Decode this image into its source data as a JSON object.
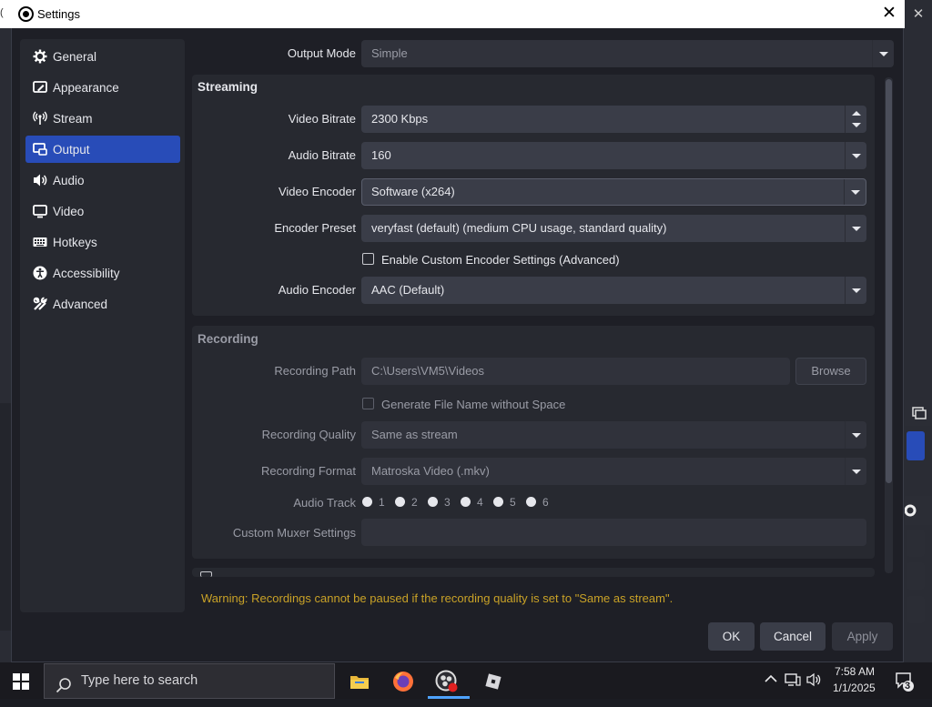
{
  "window": {
    "title": "Settings"
  },
  "sidebar": {
    "items": [
      {
        "label": "General",
        "icon": "gear-icon",
        "active": false
      },
      {
        "label": "Appearance",
        "icon": "paintbrush-icon",
        "active": false
      },
      {
        "label": "Stream",
        "icon": "broadcast-icon",
        "active": false
      },
      {
        "label": "Output",
        "icon": "output-icon",
        "active": true
      },
      {
        "label": "Audio",
        "icon": "speaker-icon",
        "active": false
      },
      {
        "label": "Video",
        "icon": "monitor-icon",
        "active": false
      },
      {
        "label": "Hotkeys",
        "icon": "keyboard-icon",
        "active": false
      },
      {
        "label": "Accessibility",
        "icon": "accessibility-icon",
        "active": false
      },
      {
        "label": "Advanced",
        "icon": "tools-icon",
        "active": false
      }
    ]
  },
  "output": {
    "mode_label": "Output Mode",
    "mode_value": "Simple",
    "streaming": {
      "title": "Streaming",
      "video_bitrate_label": "Video Bitrate",
      "video_bitrate_value": "2300 Kbps",
      "audio_bitrate_label": "Audio Bitrate",
      "audio_bitrate_value": "160",
      "video_encoder_label": "Video Encoder",
      "video_encoder_value": "Software (x264)",
      "encoder_preset_label": "Encoder Preset",
      "encoder_preset_value": "veryfast (default) (medium CPU usage, standard quality)",
      "custom_settings_label": "Enable Custom Encoder Settings (Advanced)",
      "custom_settings_checked": false,
      "audio_encoder_label": "Audio Encoder",
      "audio_encoder_value": "AAC (Default)"
    },
    "recording": {
      "title": "Recording",
      "path_label": "Recording Path",
      "path_value": "C:\\Users\\VM5\\Videos",
      "browse_label": "Browse",
      "no_space_label": "Generate File Name without Space",
      "no_space_checked": false,
      "quality_label": "Recording Quality",
      "quality_value": "Same as stream",
      "format_label": "Recording Format",
      "format_value": "Matroska Video (.mkv)",
      "audio_track_label": "Audio Track",
      "tracks": [
        "1",
        "2",
        "3",
        "4",
        "5",
        "6"
      ],
      "muxer_label": "Custom Muxer Settings",
      "muxer_value": ""
    },
    "next_section_title": ""
  },
  "warning": "Warning: Recordings cannot be paused if the recording quality is set to \"Same as stream\".",
  "buttons": {
    "ok": "OK",
    "cancel": "Cancel",
    "apply": "Apply"
  },
  "taskbar": {
    "search_placeholder": "Type here to search",
    "apps": [
      "file-explorer-icon",
      "firefox-icon",
      "obs-icon",
      "roblox-icon"
    ],
    "time": "7:58 AM",
    "date": "1/1/2025",
    "notification_count": "3"
  },
  "colors": {
    "accent": "#284cb8",
    "warning": "#c9a227",
    "background": "#1e1f26"
  }
}
